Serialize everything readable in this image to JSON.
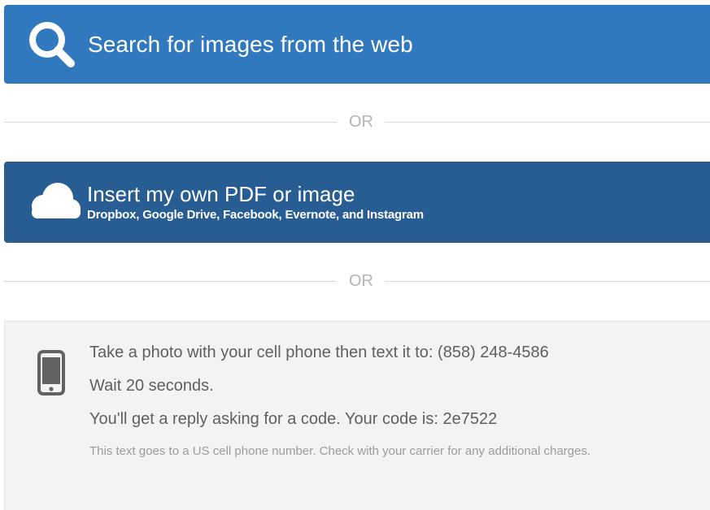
{
  "search_button": {
    "label": "Search for images from the web",
    "icon": "search-icon",
    "color": "#3179bf"
  },
  "divider_1": {
    "text": "OR"
  },
  "upload_button": {
    "label": "Insert my own PDF or image",
    "sublabel": "Dropbox, Google Drive, Facebook, Evernote, and Instagram",
    "icon": "cloud-icon",
    "color": "#275d93"
  },
  "divider_2": {
    "text": "OR"
  },
  "sms": {
    "icon": "phone-icon",
    "step1": "Take a photo with your cell phone then text it to: (858) 248-4586",
    "step2": "Wait 20 seconds.",
    "step3": "You'll get a reply asking for a code. Your code is: 2e7522",
    "note": "This text goes to a US cell phone number. Check with your carrier for any additional charges."
  }
}
